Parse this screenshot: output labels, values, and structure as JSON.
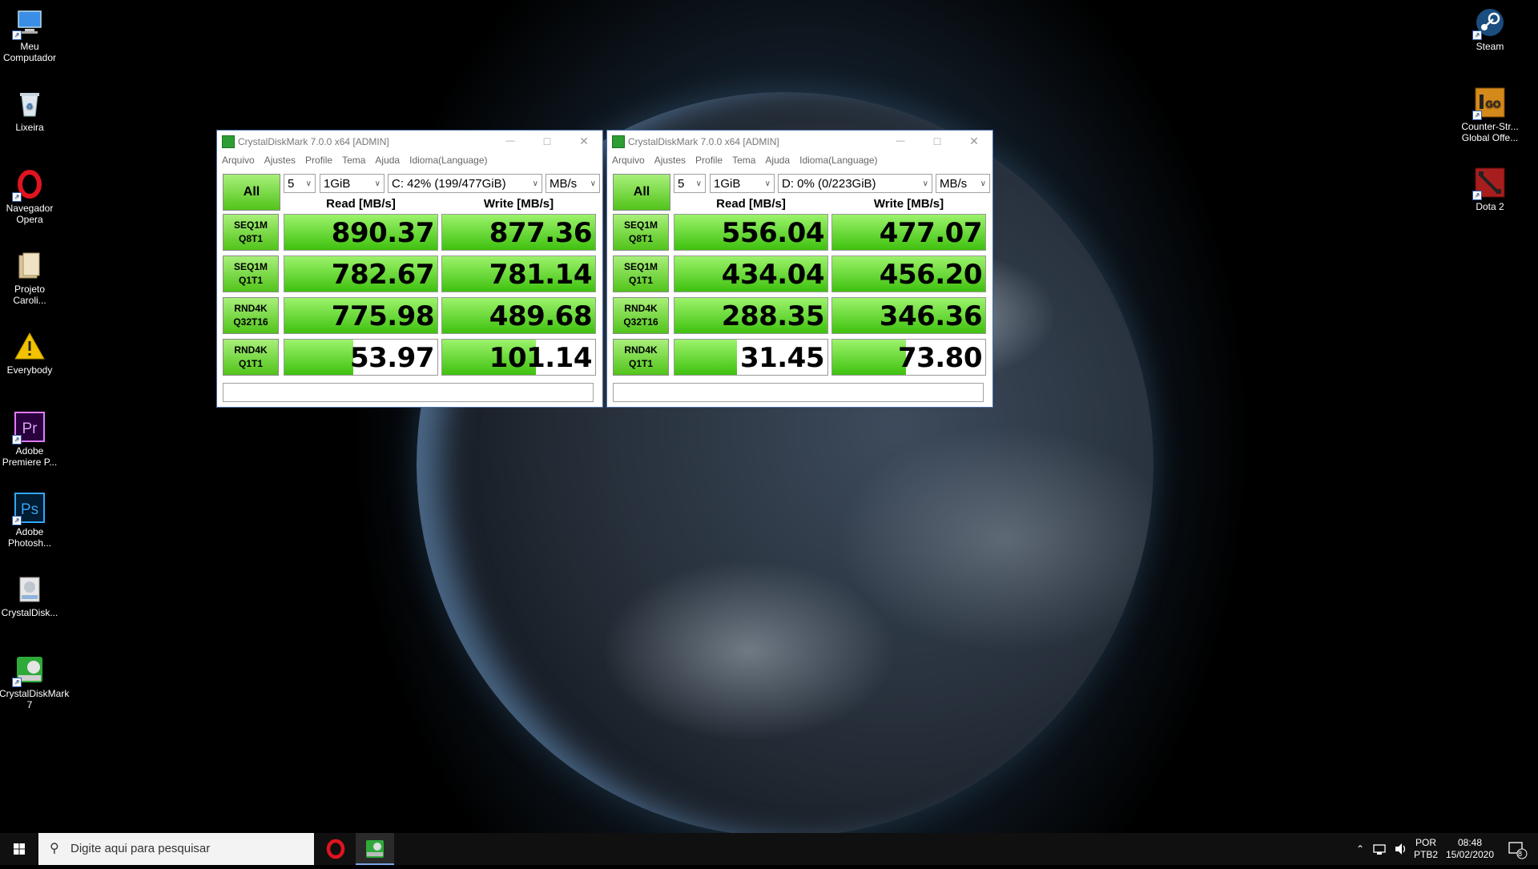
{
  "desktop_icons_left": [
    {
      "label": "Meu Computador",
      "icon": "computer-icon",
      "shortcut": true
    },
    {
      "label": "Lixeira",
      "icon": "recycle-bin-icon",
      "shortcut": false
    },
    {
      "label": "Navegador Opera",
      "icon": "opera-icon",
      "shortcut": true
    },
    {
      "label": "Projeto Caroli...",
      "icon": "folder-icon",
      "shortcut": false
    },
    {
      "label": "Everybody",
      "icon": "warning-icon",
      "shortcut": false
    },
    {
      "label": "Adobe Premiere P...",
      "icon": "premiere-icon",
      "shortcut": true
    },
    {
      "label": "Adobe Photosh...",
      "icon": "photoshop-icon",
      "shortcut": true
    },
    {
      "label": "CrystalDisk...",
      "icon": "crystaldisk-icon",
      "shortcut": false
    },
    {
      "label": "CrystalDiskMark 7",
      "icon": "crystaldiskmark-icon",
      "shortcut": true
    }
  ],
  "desktop_icons_right": [
    {
      "label": "Steam",
      "icon": "steam-icon",
      "shortcut": true
    },
    {
      "label": "Counter-Str... Global Offe...",
      "icon": "csgo-icon",
      "shortcut": true
    },
    {
      "label": "Dota 2",
      "icon": "dota2-icon",
      "shortcut": true
    }
  ],
  "windows": [
    {
      "title": "CrystalDiskMark 7.0.0 x64 [ADMIN]",
      "menu": [
        "Arquivo",
        "Ajustes",
        "Profile",
        "Tema",
        "Ajuda",
        "Idioma(Language)"
      ],
      "all_label": "All",
      "count": "5",
      "size": "1GiB",
      "drive": "C: 42% (199/477GiB)",
      "unit": "MB/s",
      "read_header": "Read [MB/s]",
      "write_header": "Write [MB/s]",
      "rows": [
        {
          "label1": "SEQ1M",
          "label2": "Q8T1",
          "read": "890.37",
          "write": "877.36",
          "read_fill": 1.0,
          "write_fill": 1.0
        },
        {
          "label1": "SEQ1M",
          "label2": "Q1T1",
          "read": "782.67",
          "write": "781.14",
          "read_fill": 1.0,
          "write_fill": 1.0
        },
        {
          "label1": "RND4K",
          "label2": "Q32T16",
          "read": "775.98",
          "write": "489.68",
          "read_fill": 1.0,
          "write_fill": 1.0
        },
        {
          "label1": "RND4K",
          "label2": "Q1T1",
          "read": "53.97",
          "write": "101.14",
          "read_fill": 0.45,
          "write_fill": 0.61
        }
      ],
      "comment": ""
    },
    {
      "title": "CrystalDiskMark 7.0.0 x64 [ADMIN]",
      "menu": [
        "Arquivo",
        "Ajustes",
        "Profile",
        "Tema",
        "Ajuda",
        "Idioma(Language)"
      ],
      "all_label": "All",
      "count": "5",
      "size": "1GiB",
      "drive": "D: 0% (0/223GiB)",
      "unit": "MB/s",
      "read_header": "Read [MB/s]",
      "write_header": "Write [MB/s]",
      "rows": [
        {
          "label1": "SEQ1M",
          "label2": "Q8T1",
          "read": "556.04",
          "write": "477.07",
          "read_fill": 1.0,
          "write_fill": 1.0
        },
        {
          "label1": "SEQ1M",
          "label2": "Q1T1",
          "read": "434.04",
          "write": "456.20",
          "read_fill": 1.0,
          "write_fill": 1.0
        },
        {
          "label1": "RND4K",
          "label2": "Q32T16",
          "read": "288.35",
          "write": "346.36",
          "read_fill": 1.0,
          "write_fill": 1.0
        },
        {
          "label1": "RND4K",
          "label2": "Q1T1",
          "read": "31.45",
          "write": "73.80",
          "read_fill": 0.41,
          "write_fill": 0.48
        }
      ],
      "comment": ""
    }
  ],
  "taskbar": {
    "search_placeholder": "Digite aqui para pesquisar",
    "lang_top": "POR",
    "lang_bottom": "PTB2",
    "time": "08:48",
    "date": "15/02/2020",
    "notification_count": "8"
  },
  "colors": {
    "green_fill": "#3fc10f",
    "window_border": "#4a6fa5",
    "taskbar": "#101010"
  }
}
